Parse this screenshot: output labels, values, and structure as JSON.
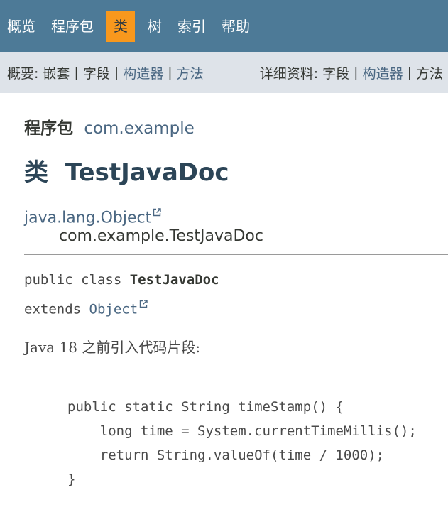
{
  "top_nav": {
    "items": [
      {
        "label": "概览"
      },
      {
        "label": "程序包"
      },
      {
        "label": "类"
      },
      {
        "label": "树"
      },
      {
        "label": "索引"
      },
      {
        "label": "帮助"
      }
    ]
  },
  "sub_nav": {
    "summary_label": "概要:",
    "summary_items": [
      "嵌套",
      "字段",
      "构造器",
      "方法"
    ],
    "detail_label": "详细资料:",
    "detail_items": [
      "字段",
      "构造器",
      "方法"
    ],
    "separator": "|"
  },
  "package": {
    "label": "程序包",
    "name": "com.example"
  },
  "class_title": {
    "kind": "类",
    "name": "TestJavaDoc"
  },
  "inheritance": {
    "parent": "java.lang.Object",
    "child": "com.example.TestJavaDoc"
  },
  "signature": {
    "line1_prefix": "public class ",
    "type_name": "TestJavaDoc",
    "line2_prefix": "extends ",
    "super_link": "Object"
  },
  "description": "Java 18 之前引入代码片段:",
  "code_lines": [
    "public static String timeStamp() {",
    "    long time = System.currentTimeMillis();",
    "    return String.valueOf(time / 1000);",
    "}"
  ],
  "colors": {
    "nav_bg": "#4d7a97",
    "active_tab": "#f8981d",
    "sub_nav_bg": "#dee3e9",
    "link": "#4a6782",
    "title": "#2c4557"
  },
  "icons": {
    "external_link": "external-link-icon"
  }
}
